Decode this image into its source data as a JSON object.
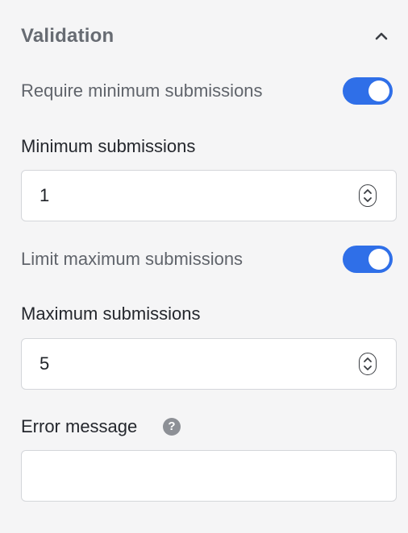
{
  "validation": {
    "title": "Validation",
    "require_min": {
      "label": "Require minimum submissions",
      "enabled": true
    },
    "min_submissions": {
      "label": "Minimum submissions",
      "value": "1"
    },
    "limit_max": {
      "label": "Limit maximum submissions",
      "enabled": true
    },
    "max_submissions": {
      "label": "Maximum submissions",
      "value": "5"
    },
    "error_message": {
      "label": "Error message",
      "value": "",
      "help_icon": "?"
    }
  },
  "icons": {
    "collapse": "chevron-up-icon",
    "stepper": "updown-stepper-icon",
    "help": "question-circle-icon"
  },
  "colors": {
    "toggle_on": "#2f6fe8",
    "background": "#f5f5f6",
    "header_text": "#676b72"
  }
}
